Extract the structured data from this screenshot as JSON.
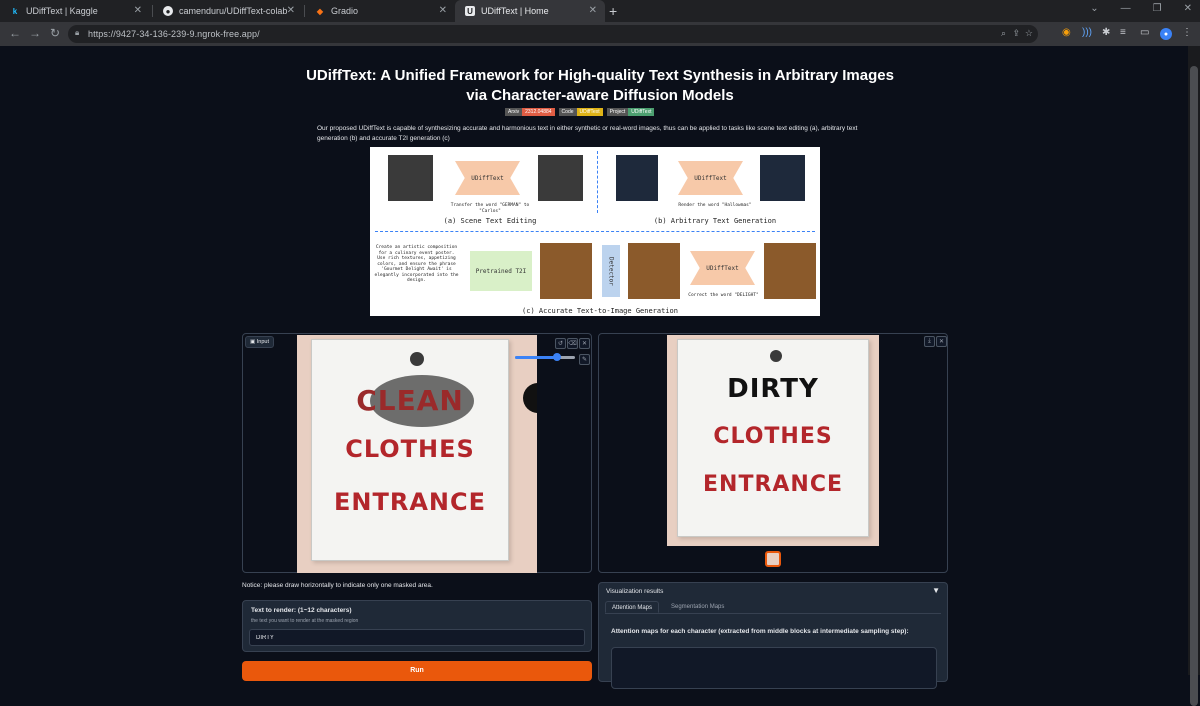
{
  "browser": {
    "tabs": [
      {
        "label": "UDiffText | Kaggle",
        "icon": "kaggle-icon"
      },
      {
        "label": "camenduru/UDiffText-colab",
        "icon": "github-icon"
      },
      {
        "label": "Gradio",
        "icon": "gradio-icon"
      },
      {
        "label": "UDiffText | Home",
        "icon": "udifftext-icon"
      }
    ],
    "url": "https://9427-34-136-239-9.ngrok-free.app/"
  },
  "header": {
    "title": "UDiffText: A Unified Framework for High-quality Text Synthesis in Arbitrary Images via Character-aware Diffusion Models",
    "badges": [
      {
        "label": "Arxiv",
        "value": "2312.04884",
        "color": "#e05d44"
      },
      {
        "label": "Code",
        "value": "UDiffText",
        "color": "#dfb317"
      },
      {
        "label": "Project",
        "value": "UDiffText",
        "color": "#4c9f70"
      }
    ],
    "description": "Our proposed UDiffText is capable of synthesizing accurate and harmonious text in either synthetic or real-word images, thus can be applied to tasks like scene text editing (a), arbitrary text generation (b) and accurate T2I generation (c)"
  },
  "figure": {
    "box_label": "UDiffText",
    "pretrained": "Pretrained T2I",
    "detector": "Detector",
    "caption_a": "(a) Scene Text Editing",
    "caption_b": "(b) Arbitrary Text Generation",
    "caption_c": "(c) Accurate Text-to-Image Generation",
    "note_a": "Transfer the word \"GERMAN\" to \"Carlos\"",
    "note_b": "Render the word \"Hallowmas\"",
    "note_c": "Correct the word \"DELIGHT\"",
    "prompt_c": "Create an artistic composition for a culinary event poster. Use rich textures, appetizing colors, and ensure the phrase 'Gourmet Delight Await' is elegantly incorporated into the design."
  },
  "input_panel": {
    "label": "Input",
    "sign_words": [
      "CLEAN",
      "CLOTHES",
      "ENTRANCE"
    ],
    "slider_value": 0.7
  },
  "output_panel": {
    "sign_words": [
      "DIRTY",
      "CLOTHES",
      "ENTRANCE"
    ]
  },
  "notice": "Notice: please draw horizontally to indicate only one masked area.",
  "text_field": {
    "label": "Text to render: (1~12 characters)",
    "info": "the text you want to render at the masked region",
    "value": "DIRTY"
  },
  "run_label": "Run",
  "visualization": {
    "title": "Visualization results",
    "tabs": [
      "Attention Maps",
      "Segmentation Maps"
    ],
    "description": "Attention maps for each character (extracted from middle blocks at intermediate sampling step):"
  },
  "colors": {
    "accent": "#ea580c",
    "background": "#0b0f19",
    "sign_text": "#b3262b"
  }
}
